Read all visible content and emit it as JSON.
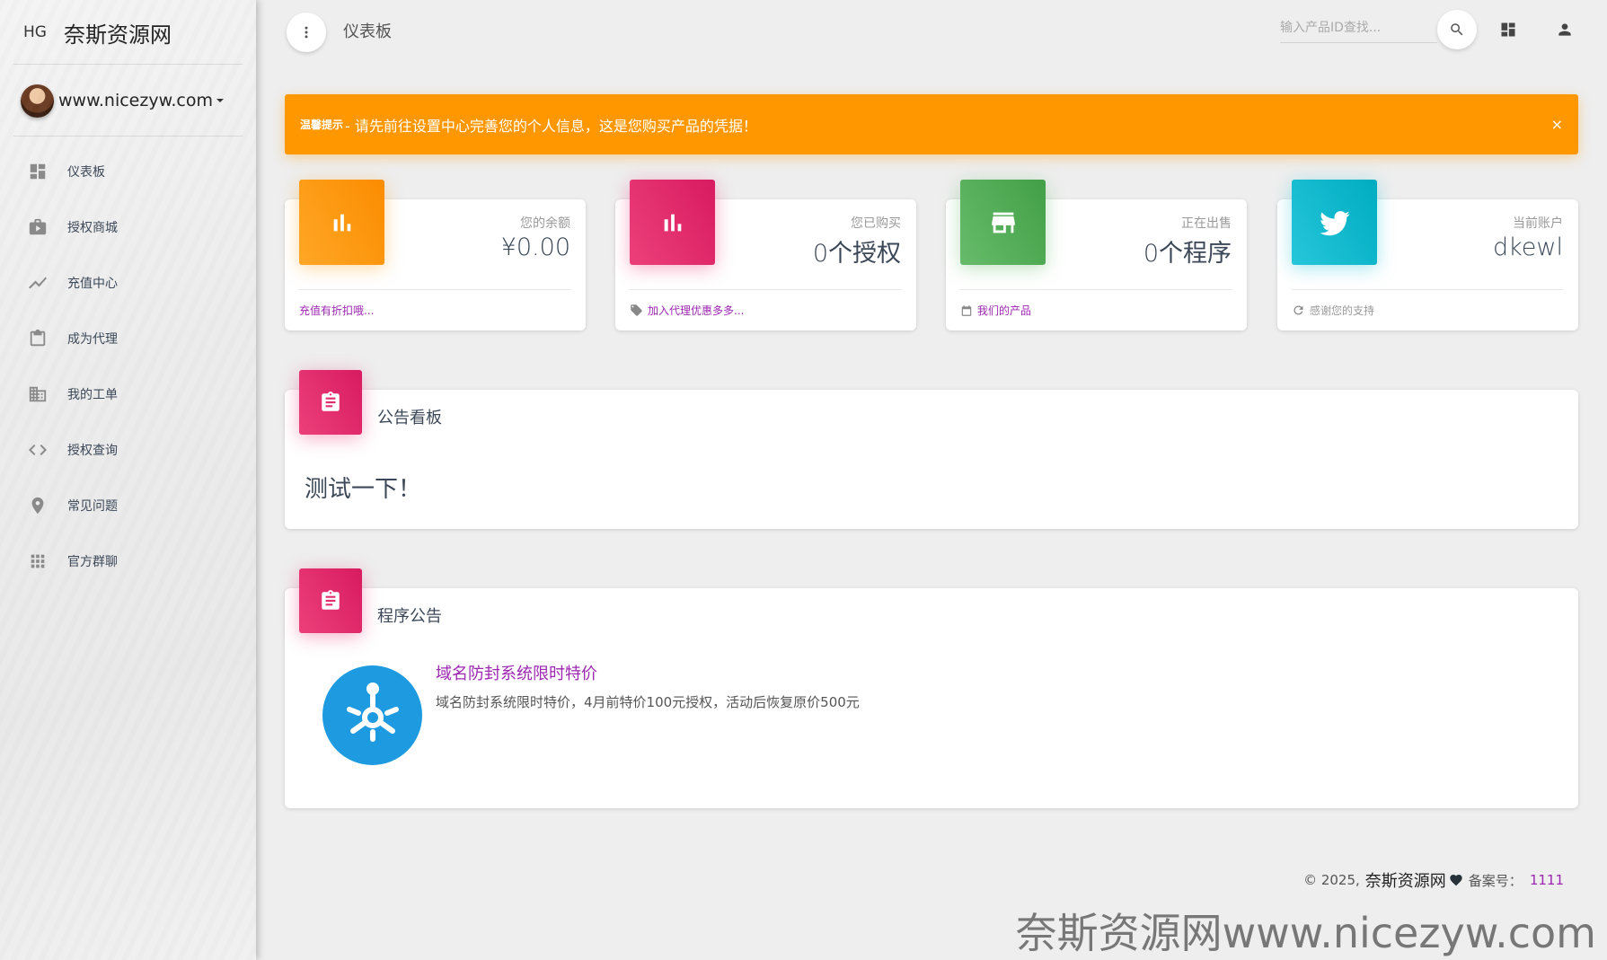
{
  "sidebar": {
    "logo_mini": "HG",
    "logo_text": "奈斯资源网",
    "user_name": "www.nicezyw.com",
    "items": [
      {
        "label": "仪表板",
        "icon": "dashboard-icon"
      },
      {
        "label": "授权商城",
        "icon": "briefcase-icon"
      },
      {
        "label": "充值中心",
        "icon": "trending-up-icon"
      },
      {
        "label": "成为代理",
        "icon": "clipboard-icon"
      },
      {
        "label": "我的工单",
        "icon": "building-icon"
      },
      {
        "label": "授权查询",
        "icon": "code-icon"
      },
      {
        "label": "常见问题",
        "icon": "location-pin-icon"
      },
      {
        "label": "官方群聊",
        "icon": "apps-grid-icon"
      }
    ]
  },
  "topbar": {
    "more_icon": "more-vertical-icon",
    "page_title": "仪表板",
    "search_placeholder": "输入产品ID查找...",
    "search_icon": "search-icon",
    "dashboard_icon": "dashboard-icon",
    "person_icon": "person-icon"
  },
  "alert": {
    "strong": "温馨提示",
    "text": " - 请先前往设置中心完善您的个人信息，这是您购买产品的凭据！",
    "close": "×",
    "color": "#ff9800"
  },
  "stats": [
    {
      "category": "您的余额",
      "value": "¥0.00",
      "footer": "充值有折扣哦...",
      "footer_icon": "",
      "icon": "bar-chart-icon",
      "color": "#ff9800"
    },
    {
      "category": "您已购买",
      "value": "0个授权",
      "footer": "加入代理优惠多多...",
      "footer_icon": "tag-icon",
      "icon": "bar-chart-icon",
      "color": "#e91e63"
    },
    {
      "category": "正在出售",
      "value": "0个程序",
      "footer": "我们的产品",
      "footer_icon": "calendar-icon",
      "icon": "store-icon",
      "color": "#4caf50"
    },
    {
      "category": "当前账户",
      "value": "dkewl",
      "footer": "感谢您的支持",
      "footer_icon": "refresh-icon",
      "icon": "twitter-bird-icon",
      "color": "#00bcd4"
    }
  ],
  "bulletin": {
    "title": "公告看板",
    "content": "测试一下！",
    "icon": "clipboard-icon"
  },
  "program_notice": {
    "title": "程序公告",
    "icon": "clipboard-icon",
    "item_title": "域名防封系统限时特价",
    "item_desc": "域名防封系统限时特价，4月前特价100元授权，活动后恢复原价500元",
    "logo_icon": "network-hub-icon"
  },
  "footer": {
    "copyright": "© 2025,",
    "brand": "奈斯资源网",
    "icp_label": "备案号：",
    "icp_number": "1111"
  },
  "watermark": "奈斯资源网www.nicezyw.com"
}
